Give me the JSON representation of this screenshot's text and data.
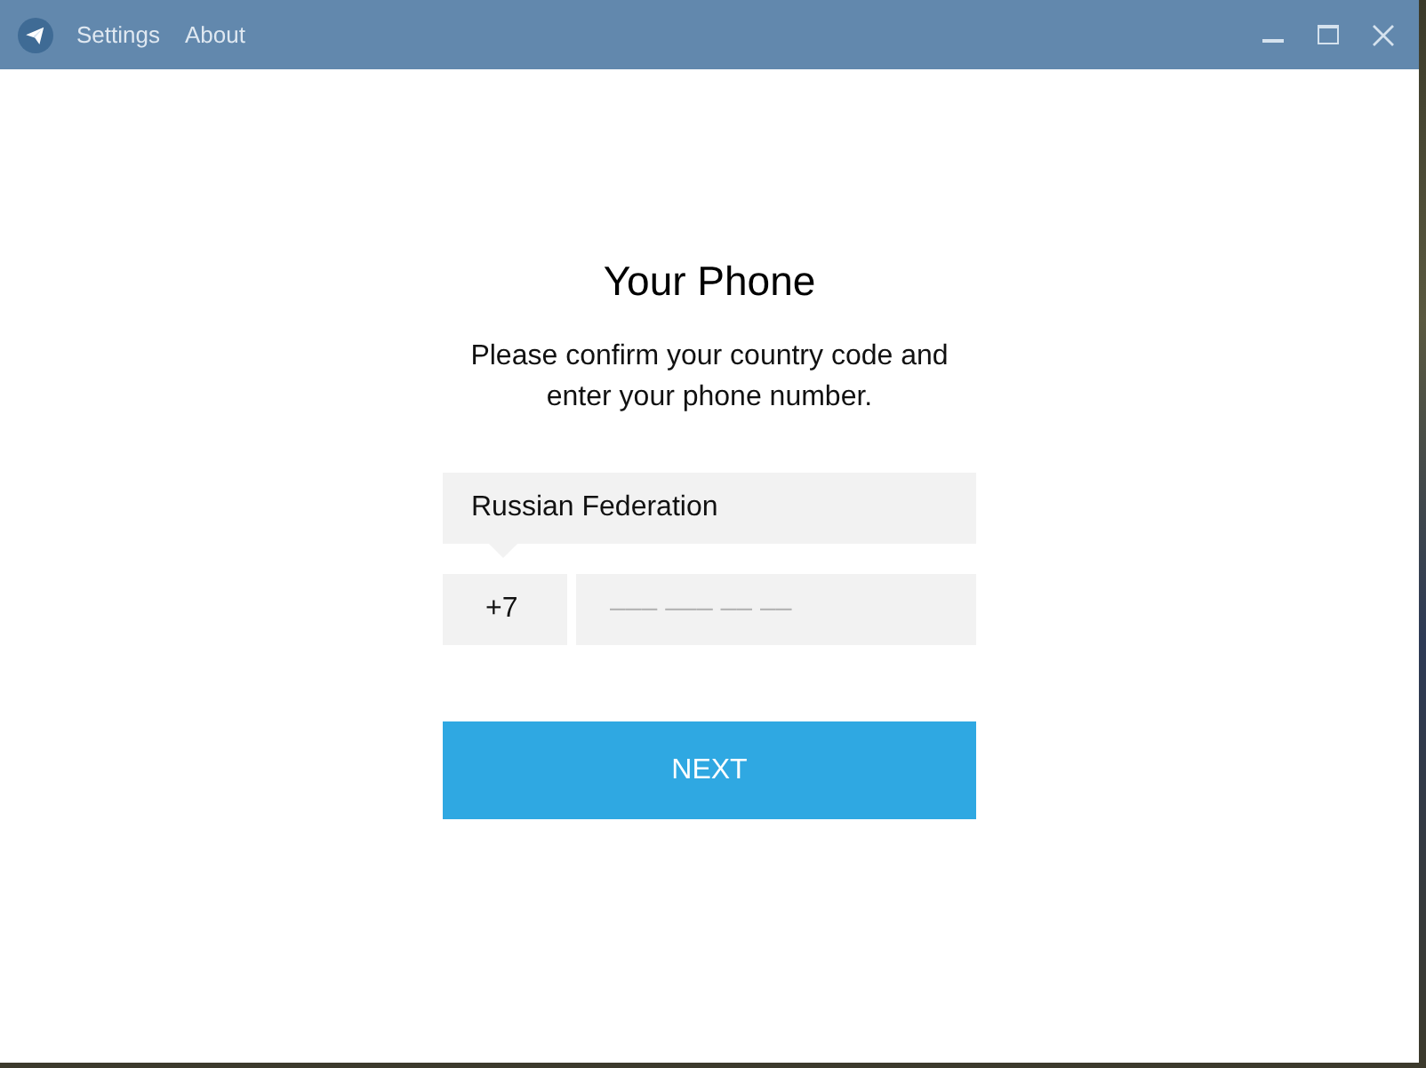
{
  "title_bar": {
    "menu": [
      {
        "label": "Settings"
      },
      {
        "label": "About"
      }
    ],
    "controls": [
      {
        "kind": "minimize"
      },
      {
        "kind": "maximize"
      },
      {
        "kind": "close"
      }
    ]
  },
  "login": {
    "title": "Your Phone",
    "description": "Please confirm your country code and enter your phone number.",
    "country": {
      "value": "Russian Federation"
    },
    "code": {
      "value": "+7"
    },
    "phone": {
      "placeholder": "––– ––– –– ––"
    },
    "button": {
      "label": "NEXT"
    }
  }
}
